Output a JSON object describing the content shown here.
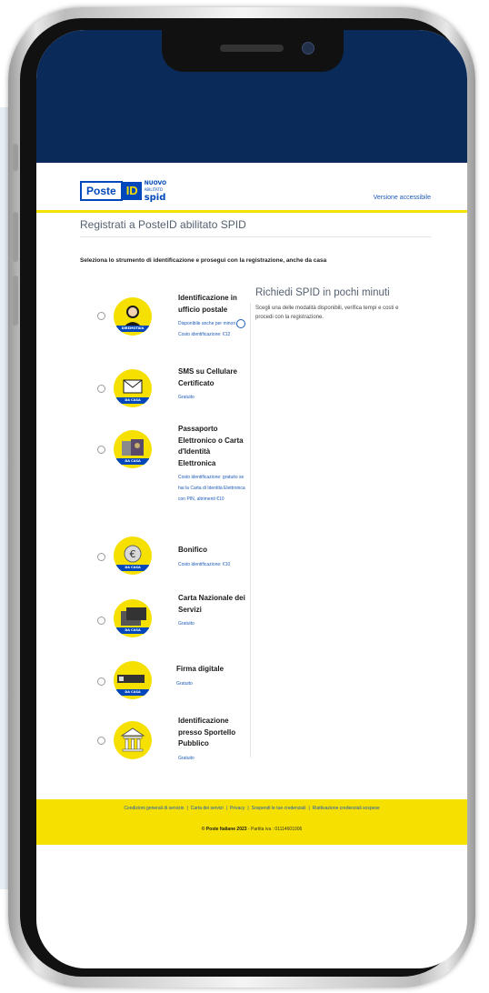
{
  "header": {
    "logo": {
      "poste": "Poste",
      "id": "ID",
      "nuovo": "NUOVO",
      "abilitato": "ABILITATO",
      "spid": "spid"
    },
    "accessible_link": "Versione accessibile"
  },
  "page_title": "Registrati a PosteID abilitato SPID",
  "instruction": "Seleziona lo strumento di identificazione e prosegui con la registrazione, anche da casa",
  "options": [
    {
      "title": "Identificazione in ufficio postale",
      "desc": "Disponibile anche per minori",
      "cost": "Costo identificazione: €12",
      "icon": "person-at-counter-icon",
      "badge": "DIREMOTAIA"
    },
    {
      "title": "SMS su Cellulare Certificato",
      "desc": "Gratuito",
      "cost": "",
      "icon": "envelope-phone-icon",
      "badge": "DA CASA"
    },
    {
      "title": "Passaporto Elettronico o Carta d'Identità Elettronica",
      "desc": "Costo identificazione: gratuito se hai la Carta di Identità Elettronica con PIN, altrimenti €10",
      "cost": "",
      "icon": "passport-id-card-icon",
      "badge": "DA CASA"
    },
    {
      "title": "Bonifico",
      "desc": "Costo identificazione: €10",
      "cost": "",
      "icon": "euro-coin-icon",
      "badge": "DA CASA"
    },
    {
      "title": "Carta Nazionale dei Servizi",
      "desc": "Gratuito",
      "cost": "",
      "icon": "smart-card-reader-icon",
      "badge": "DA CASA"
    },
    {
      "title": "Firma digitale",
      "desc": "Gratuito",
      "cost": "",
      "icon": "usb-key-icon",
      "badge": "DA CASA"
    },
    {
      "title": "Identificazione presso Sportello Pubblico",
      "desc": "Gratuito",
      "cost": "",
      "icon": "public-building-icon",
      "badge": ""
    }
  ],
  "right_panel": {
    "heading": "Richiedi SPID in pochi minuti",
    "description": "Scegli una delle modalità disponibili, verifica tempi e costi e procedi con la registrazione."
  },
  "footer": {
    "links": [
      "Condizioni generali di servizio",
      "Carta dei servizi",
      "Privacy",
      "Sospendi le tue credenziali",
      "Riattivazione credenziali sospese"
    ],
    "copyright": "© Poste Italiane 2023",
    "vat": " - Partita iva : 01114601006"
  },
  "colors": {
    "navy": "#0a2a5a",
    "brand_blue": "#0047bb",
    "brand_yellow": "#f5e000",
    "link": "#1e5bb8"
  }
}
